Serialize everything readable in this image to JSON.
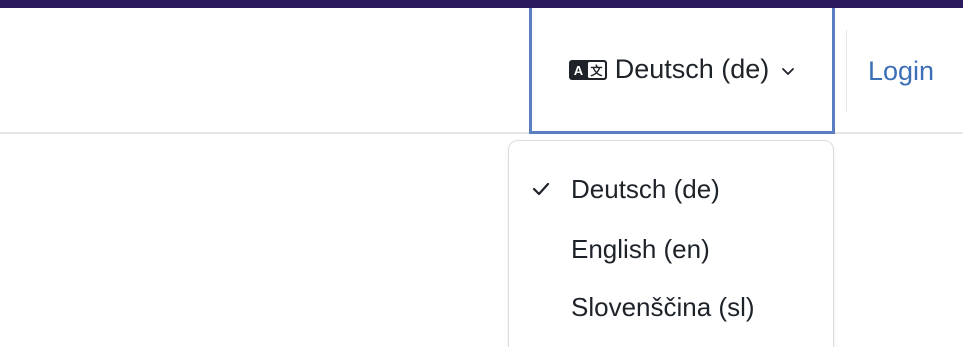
{
  "navbar": {
    "language_selector": {
      "icon": "language-icon",
      "label": "Deutsch (de)",
      "chevron_icon": "chevron-down-icon"
    },
    "login_label": "Login"
  },
  "language_menu": {
    "items": [
      {
        "label": "Deutsch (de)",
        "selected": true
      },
      {
        "label": "English (en)",
        "selected": false
      },
      {
        "label": "Slovenščina (sl)",
        "selected": false
      }
    ]
  },
  "colors": {
    "top_accent": "#2a1a5e",
    "focus_outline": "#5a7fc0",
    "link": "#3d6fb6",
    "text": "#1e2329"
  }
}
